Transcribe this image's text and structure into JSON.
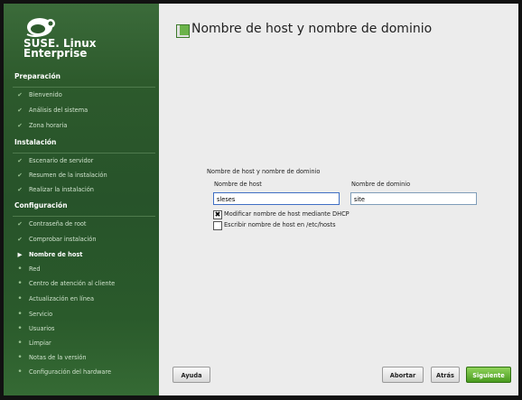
{
  "brand": {
    "name_line1": "SUSE. Linux",
    "name_line2": "Enterprise"
  },
  "sidebar": {
    "sections": [
      {
        "title": "Preparación",
        "items": [
          {
            "label": "Bienvenido",
            "state": "done"
          },
          {
            "label": "Análisis del sistema",
            "state": "done"
          },
          {
            "label": "Zona horaria",
            "state": "done"
          }
        ]
      },
      {
        "title": "Instalación",
        "items": [
          {
            "label": "Escenario de servidor",
            "state": "done"
          },
          {
            "label": "Resumen de la instalación",
            "state": "done"
          },
          {
            "label": "Realizar la instalación",
            "state": "done"
          }
        ]
      },
      {
        "title": "Configuración",
        "items": [
          {
            "label": "Contraseña de root",
            "state": "done"
          },
          {
            "label": "Comprobar instalación",
            "state": "done"
          },
          {
            "label": "Nombre de host",
            "state": "current"
          },
          {
            "label": "Red",
            "state": "todo"
          },
          {
            "label": "Centro de atención al cliente",
            "state": "todo"
          },
          {
            "label": "Actualización en línea",
            "state": "todo"
          },
          {
            "label": "Servicio",
            "state": "todo"
          },
          {
            "label": "Usuarios",
            "state": "todo"
          },
          {
            "label": "Limpiar",
            "state": "todo"
          },
          {
            "label": "Notas de la versión",
            "state": "todo"
          },
          {
            "label": "Configuración del hardware",
            "state": "todo"
          }
        ]
      }
    ]
  },
  "main": {
    "title": "Nombre de host y nombre de dominio",
    "group_label": "Nombre de host y nombre de dominio",
    "hostname_label": "Nombre de host",
    "hostname_value": "sleses",
    "domain_label": "Nombre de dominio",
    "domain_value": "site",
    "dhcp_checkbox_label": "Modificar nombre de host mediante DHCP",
    "dhcp_checked": true,
    "hosts_checkbox_label": "Escribir nombre de host en /etc/hosts",
    "hosts_checked": false
  },
  "buttons": {
    "help": "Ayuda",
    "abort": "Abortar",
    "back": "Atrás",
    "next": "Siguiente"
  },
  "colors": {
    "accent": "#4a9b1f",
    "sidebar": "#2d5a2c"
  },
  "icons": {
    "done": "checkmark-icon",
    "current": "arrow-right-icon",
    "todo": "dot-icon"
  }
}
